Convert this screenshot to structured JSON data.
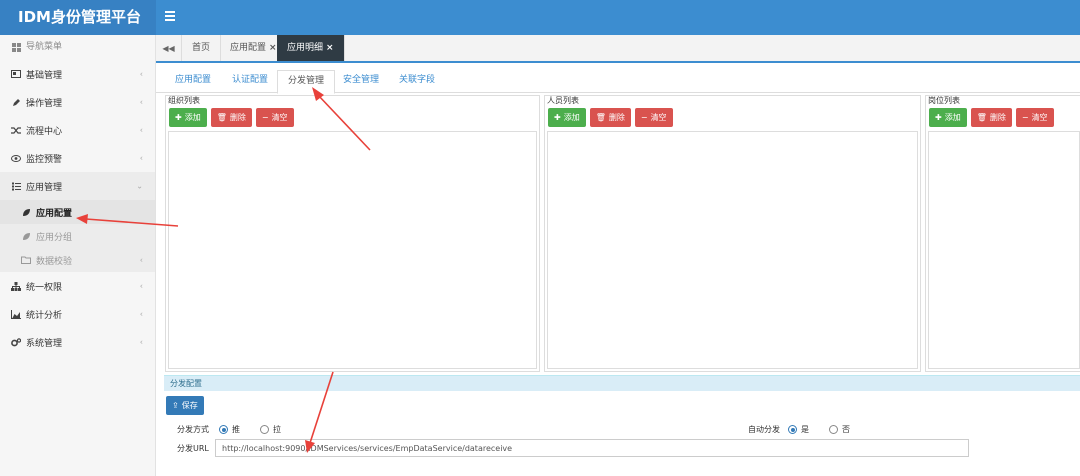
{
  "app": {
    "title": "IDM身份管理平台"
  },
  "sidebar": {
    "nav_header": "导航菜单",
    "items": [
      {
        "label": "基础管理",
        "icon": "card-icon"
      },
      {
        "label": "操作管理",
        "icon": "pencil-icon"
      },
      {
        "label": "流程中心",
        "icon": "shuffle-icon"
      },
      {
        "label": "监控预警",
        "icon": "eye-icon"
      },
      {
        "label": "应用管理",
        "icon": "list-icon",
        "expanded": true
      },
      {
        "label": "统一权限",
        "icon": "sitemap-icon"
      },
      {
        "label": "统计分析",
        "icon": "area-chart-icon"
      },
      {
        "label": "系统管理",
        "icon": "gears-icon"
      }
    ],
    "subitems": [
      {
        "label": "应用配置",
        "active": true
      },
      {
        "label": "应用分组"
      },
      {
        "label": "数据校验"
      }
    ]
  },
  "tabs": [
    {
      "label": "首页"
    },
    {
      "label": "应用配置",
      "close": "×"
    },
    {
      "label": "应用明细",
      "close": "×",
      "active": true
    }
  ],
  "subtabs": [
    {
      "label": "应用配置"
    },
    {
      "label": "认证配置"
    },
    {
      "label": "分发管理",
      "active": true
    },
    {
      "label": "安全管理"
    },
    {
      "label": "关联字段"
    }
  ],
  "panels": [
    {
      "title": "组织列表",
      "add": "添加",
      "delete": "删除",
      "clear": "清空"
    },
    {
      "title": "人员列表",
      "add": "添加",
      "delete": "删除",
      "clear": "清空"
    },
    {
      "title": "岗位列表",
      "add": "添加",
      "delete": "删除",
      "clear": "清空"
    }
  ],
  "config": {
    "header": "分发配置",
    "save_label": "保存",
    "method_label": "分发方式",
    "method_options": [
      "推",
      "拉"
    ],
    "method_selected": "推",
    "auto_label": "自动分发",
    "auto_options": [
      "是",
      "否"
    ],
    "auto_selected": "是",
    "url_label": "分发URL",
    "url_value": "http://localhost:9090/IDMServices/services/EmpDataService/datareceive"
  },
  "colors": {
    "topbar": "#3c8dd0",
    "active_tab": "#2f3b44",
    "add_button": "#4cae4c",
    "delete_button": "#d9534f",
    "save_button": "#337ab7",
    "annotation_arrow": "#e8413a"
  }
}
